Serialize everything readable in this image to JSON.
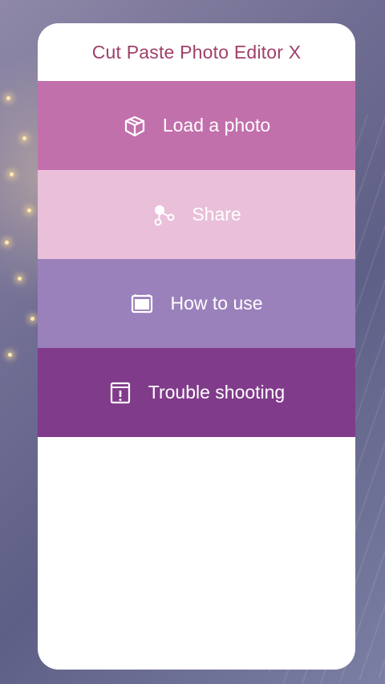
{
  "app": {
    "title": "Cut Paste Photo Editor X"
  },
  "menu": {
    "items": [
      {
        "label": "Load a photo",
        "icon": "box-icon",
        "color": "#c270ac"
      },
      {
        "label": "Share",
        "icon": "share-icon",
        "color": "#e9bfd9"
      },
      {
        "label": "How to use",
        "icon": "window-icon",
        "color": "#9b81bb"
      },
      {
        "label": "Trouble shooting",
        "icon": "alert-window-icon",
        "color": "#813b8b"
      }
    ]
  },
  "colors": {
    "title_text": "#a0406a",
    "card_background": "#ffffff"
  }
}
